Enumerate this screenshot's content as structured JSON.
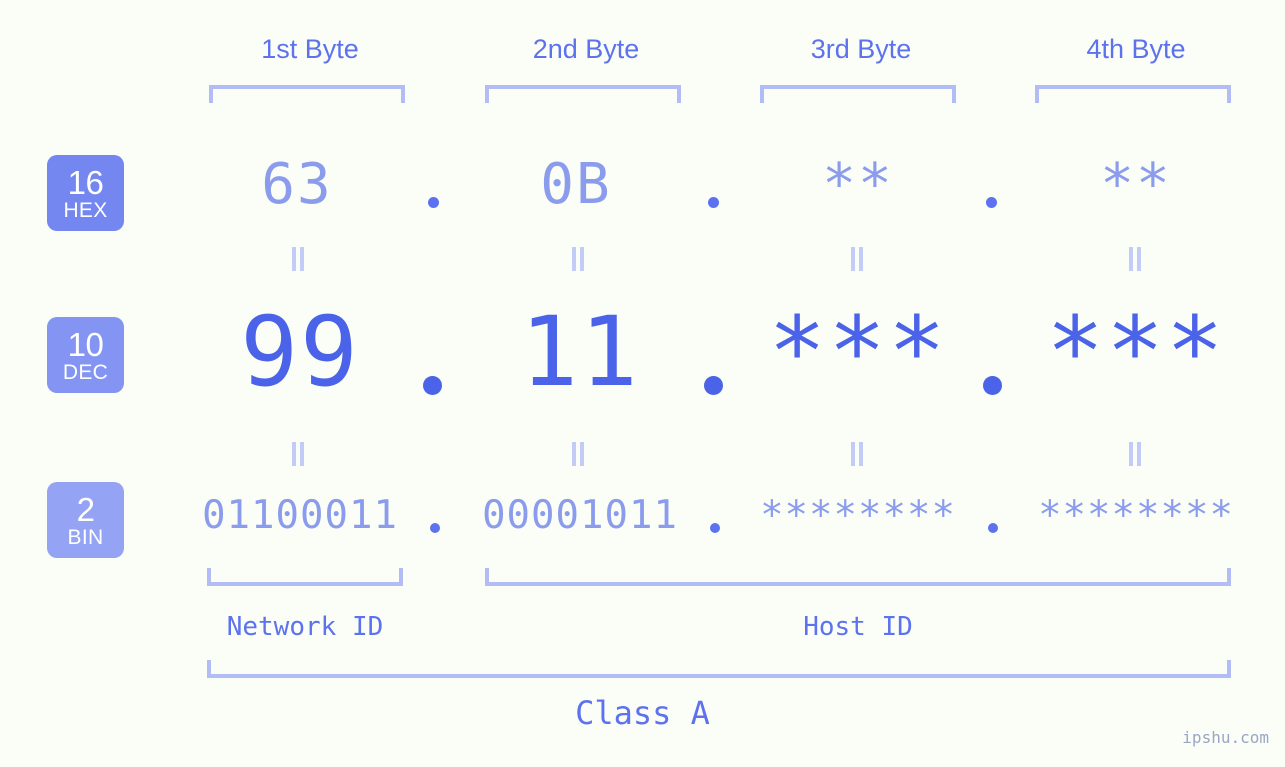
{
  "watermark": "ipshu.com",
  "byte_headers": [
    {
      "label": "1st Byte"
    },
    {
      "label": "2nd Byte"
    },
    {
      "label": "3rd Byte"
    },
    {
      "label": "4th Byte"
    }
  ],
  "bases": [
    {
      "id": "hex",
      "number": "16",
      "abbr": "HEX",
      "color": "#7486ef"
    },
    {
      "id": "dec",
      "number": "10",
      "abbr": "DEC",
      "color": "#8394f2"
    },
    {
      "id": "bin",
      "number": "2",
      "abbr": "BIN",
      "color": "#94a3f4"
    }
  ],
  "rows": {
    "hex": {
      "values": [
        "63",
        "0B",
        "**",
        "**"
      ],
      "separator": "."
    },
    "dec": {
      "values": [
        "99",
        "11",
        "***",
        "***"
      ],
      "separator": "."
    },
    "bin": {
      "values": [
        "01100011",
        "00001011",
        "********",
        "********"
      ],
      "separator": "."
    }
  },
  "equals_symbol": "=",
  "sections": {
    "network_id": "Network ID",
    "host_id": "Host ID"
  },
  "class_label": "Class A",
  "colors": {
    "background": "#fbfdf7",
    "header_text": "#5c72ee",
    "bracket": "#b3bdf5",
    "hex_value": "#8b9ced",
    "dec_value": "#4a63e8",
    "bin_value": "#8b9ced",
    "equals": "#c3cbf7",
    "badge_hex": "#7486ef",
    "badge_dec": "#8394f2",
    "badge_bin": "#94a3f4",
    "watermark": "#9aa6c4"
  }
}
